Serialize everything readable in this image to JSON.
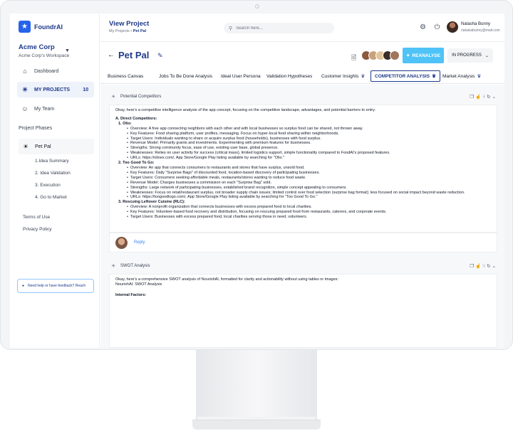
{
  "brand": {
    "name": "FoundrAI"
  },
  "workspace": {
    "name": "Acme Corp",
    "subtitle": "Acme Corp's Workspace"
  },
  "nav": [
    {
      "label": "Dashboard",
      "icon": "home-icon"
    },
    {
      "label": "MY PROJECTS",
      "icon": "bulb-icon",
      "count": "10"
    },
    {
      "label": "My Team",
      "icon": "team-icon"
    }
  ],
  "phases": {
    "label": "Project Phases",
    "project": "Pet Pal",
    "items": [
      "1.Idea Summary",
      "2. Idea Validation",
      "3. Execution",
      "4. Go to Market"
    ]
  },
  "footer_links": [
    "Terms of Use",
    "Privacy Policy"
  ],
  "help": {
    "text": "Need help or have feedback? Reach"
  },
  "topbar": {
    "title": "View Project",
    "breadcrumb_parent": "My Projects",
    "breadcrumb_sep": "•",
    "breadcrumb_current": "Pet Pal",
    "search_placeholder": "Search here..."
  },
  "user": {
    "name": "Natasha Bunny",
    "email": "natasiabunny@mail.com"
  },
  "project": {
    "name": "Pet Pal",
    "reanalyse_label": "REANALYSE",
    "status": "IN PROGRESS"
  },
  "tabs": [
    {
      "label": "Business Canvas",
      "premium": false
    },
    {
      "label": "Jobs To  Be Done Analysis",
      "premium": false
    },
    {
      "label": "Ideal User Persona",
      "premium": false
    },
    {
      "label": "Validation Hypotheses",
      "premium": false
    },
    {
      "label": "Customer Insights",
      "premium": true
    },
    {
      "label": "COMPETITOR ANALYSIS",
      "premium": true,
      "active": true
    },
    {
      "label": "Market Analysis",
      "premium": true
    }
  ],
  "cards": {
    "competitors": {
      "title": "Potential Competitors",
      "intro": "Okay, here's a competitive intelligence analysis of the app concept, focusing on the competitive landscape, advantages, and potential barriers to entry.",
      "heading": "A. Direct Competitors:",
      "entries": [
        {
          "name": "1. Olio:",
          "lines": [
            "Overview: A free app connecting neighbors with each other and with local businesses so surplus food can be shared, not thrown away.",
            "Key Features: Food sharing platform, user profiles, messaging. Focus on hyper-local food sharing within neighborhoods.",
            "Target Users: Individuals wanting to share or acquire surplus food (households), businesses with food surplus.",
            "Revenue Model: Primarily grants and investments. Experimenting with premium features for businesses.",
            "Strengths: Strong community focus, ease of use, existing user base, global presence.",
            "Weaknesses: Relies on user activity for success (critical mass), limited logistics support, simple functionality compared to FoodAI's proposed features.",
            "URLs: https://olioex.com/, App Store/Google Play listing available by searching for \"Olio.\""
          ]
        },
        {
          "name": "2. Too Good To Go:",
          "lines": [
            "Overview: An app that connects consumers to restaurants and stores that have surplus, unsold food.",
            "Key Features: Daily \"Surprise Bags\" of discounted food, location-based discovery of participating businesses.",
            "Target Users: Consumers seeking affordable meals, restaurants/stores wanting to reduce food waste.",
            "Revenue Model: Charges businesses a commission on each \"Surprise Bag\" sold.",
            "Strengths: Large network of participating businesses, established brand recognition, simple concept appealing to consumers.",
            "Weaknesses: Focus on retail/restaurant surplus, not broader supply chain issues; limited control over food selection (surprise bag format); less focused on social impact beyond waste reduction.",
            "URLs: https://toogoodtogo.com/, App Store/Google Play listing available by searching for \"Too Good To Go.\""
          ]
        },
        {
          "name": "3. Rescuing Leftover Cuisine (RLC):",
          "lines": [
            "Overview: A nonprofit organization that connects businesses with excess prepared food to local charities.",
            "Key Features: Volunteer-based food recovery and distribution, focusing on rescuing prepared food from restaurants, caterers, and corporate events.",
            "Target Users: Businesses with excess prepared food, local charities serving those in need, volunteers."
          ]
        }
      ],
      "reply_label": "Reply"
    },
    "swot": {
      "title": "SWOT Analysis",
      "intro": "Okay, here's a comprehensive SWOT analysis of NourishAI, formatted for clarity and actionability without using tables or images:",
      "line2": "NourishAI: SWOT Analysis",
      "heading": "Internal Factors:"
    }
  },
  "colors": {
    "accent": "#1e3a8a",
    "reanalyse": "#4fc3f7",
    "link": "#3b82f6"
  }
}
